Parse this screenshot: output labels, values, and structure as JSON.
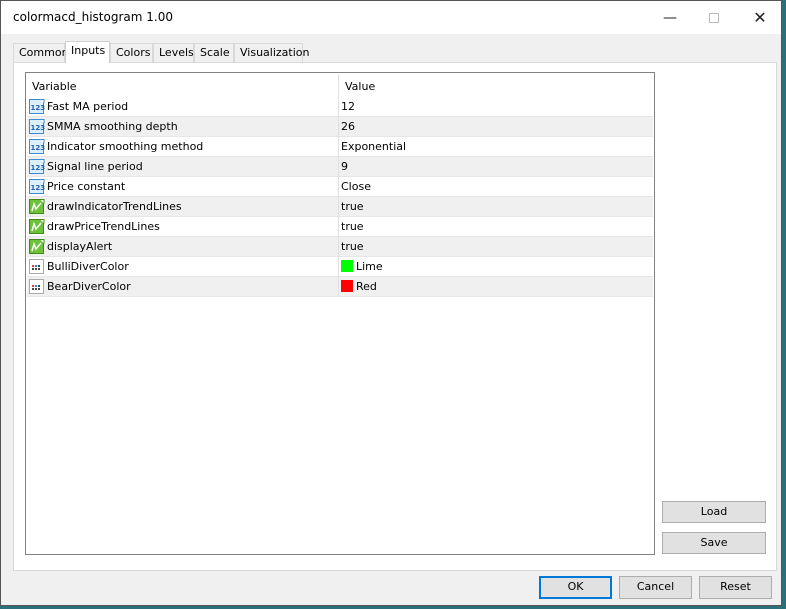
{
  "window": {
    "title": "colormacd_histogram 1.00"
  },
  "tabs": [
    {
      "label": "Common"
    },
    {
      "label": "Inputs",
      "active": true
    },
    {
      "label": "Colors"
    },
    {
      "label": "Levels"
    },
    {
      "label": "Scale"
    },
    {
      "label": "Visualization"
    }
  ],
  "table": {
    "headers": {
      "variable": "Variable",
      "value": "Value"
    },
    "rows": [
      {
        "variable": "Fast MA period",
        "value": "12",
        "icon": "numeric-123-icon"
      },
      {
        "variable": "SMMA smoothing depth",
        "value": "26",
        "icon": "numeric-123-icon"
      },
      {
        "variable": "Indicator smoothing method",
        "value": "Exponential",
        "icon": "numeric-123-icon"
      },
      {
        "variable": "Signal line period",
        "value": "9",
        "icon": "numeric-123-icon"
      },
      {
        "variable": "Price constant",
        "value": "Close",
        "icon": "numeric-123-icon"
      },
      {
        "variable": "drawIndicatorTrendLines",
        "value": "true",
        "icon": "boolean-icon"
      },
      {
        "variable": "drawPriceTrendLines",
        "value": "true",
        "icon": "boolean-icon"
      },
      {
        "variable": "displayAlert",
        "value": "true",
        "icon": "boolean-icon"
      },
      {
        "variable": "BulliDiverColor",
        "value": "Lime",
        "icon": "color-icon",
        "swatch": "#00ff00"
      },
      {
        "variable": "BearDiverColor",
        "value": "Red",
        "icon": "color-icon",
        "swatch": "#ff0000"
      }
    ]
  },
  "buttons": {
    "load": "Load",
    "save": "Save",
    "ok": "OK",
    "cancel": "Cancel",
    "reset": "Reset"
  }
}
